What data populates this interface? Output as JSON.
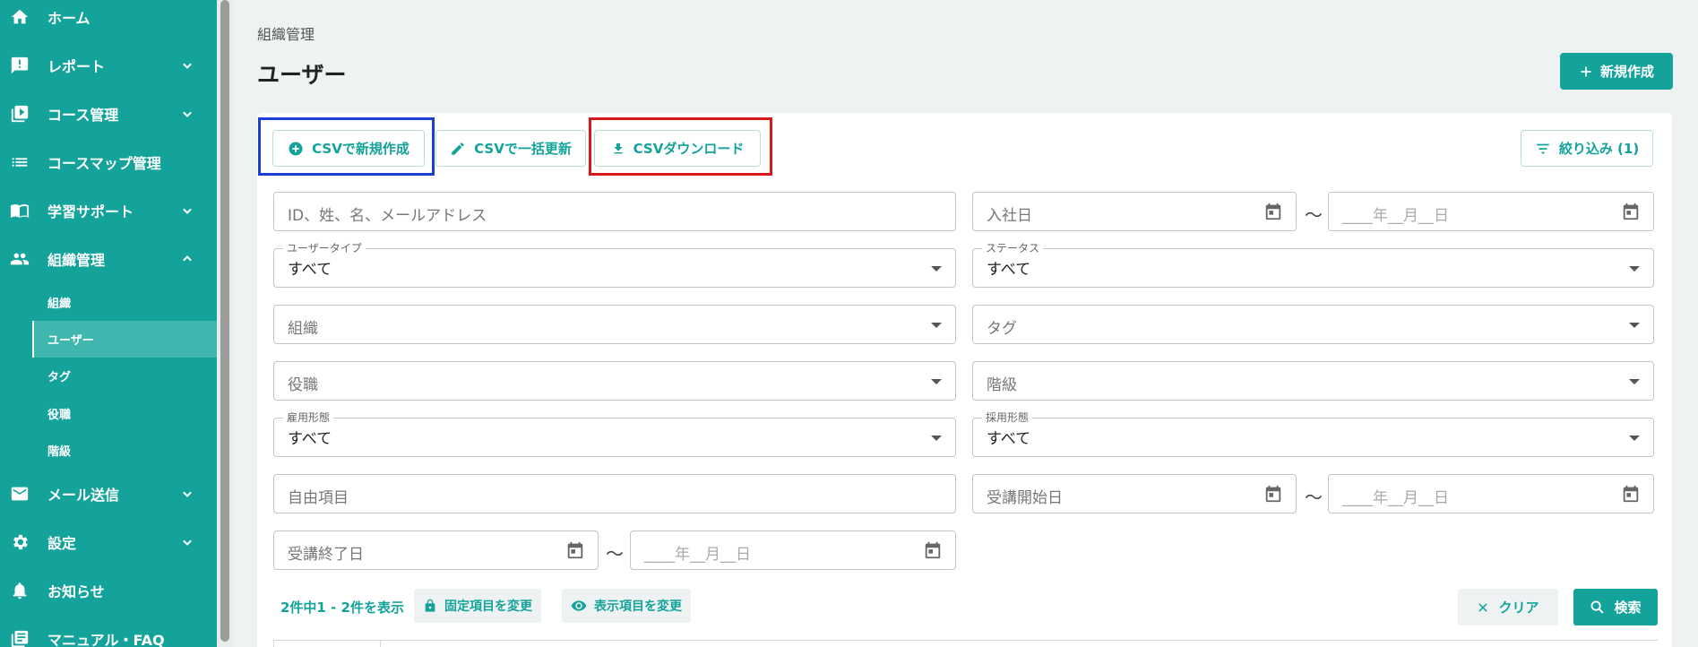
{
  "sidebar": {
    "items": [
      {
        "label": "ホーム",
        "icon": "home-icon",
        "expand": "none"
      },
      {
        "label": "レポート",
        "icon": "report-icon",
        "expand": "down"
      },
      {
        "label": "コース管理",
        "icon": "course-play-icon",
        "expand": "down"
      },
      {
        "label": "コースマップ管理",
        "icon": "list-icon",
        "expand": "none"
      },
      {
        "label": "学習サポート",
        "icon": "book-icon",
        "expand": "down"
      },
      {
        "label": "組織管理",
        "icon": "people-icon",
        "expand": "up"
      },
      {
        "label": "メール送信",
        "icon": "mail-icon",
        "expand": "down"
      },
      {
        "label": "設定",
        "icon": "gear-icon",
        "expand": "down"
      },
      {
        "label": "お知らせ",
        "icon": "bell-icon",
        "expand": "none"
      },
      {
        "label": "マニュアル・FAQ",
        "icon": "manual-icon",
        "expand": "none"
      }
    ],
    "subitems": [
      {
        "label": "組織",
        "active": false
      },
      {
        "label": "ユーザー",
        "active": true
      },
      {
        "label": "タグ",
        "active": false
      },
      {
        "label": "役職",
        "active": false
      },
      {
        "label": "階級",
        "active": false
      }
    ]
  },
  "header": {
    "breadcrumb": "組織管理",
    "title": "ユーザー",
    "new_button": "新規作成"
  },
  "toolbar": {
    "csv_create": "CSVで新規作成",
    "csv_update": "CSVで一括更新",
    "csv_download": "CSVダウンロード",
    "filter": "絞り込み (1)"
  },
  "filters": {
    "keyword_placeholder": "ID、姓、名、メールアドレス",
    "hire_date_placeholder": "入社日",
    "date_placeholder": "____年__月__日",
    "user_type_label": "ユーザータイプ",
    "user_type_value": "すべて",
    "status_label": "ステータス",
    "status_value": "すべて",
    "org_placeholder": "組織",
    "tag_placeholder": "タグ",
    "position_placeholder": "役職",
    "rank_placeholder": "階級",
    "employment_label": "雇用形態",
    "employment_value": "すべて",
    "recruit_label": "採用形態",
    "recruit_value": "すべて",
    "free_placeholder": "自由項目",
    "start_date_placeholder": "受講開始日",
    "end_date_placeholder": "受講終了日",
    "tilde": "～"
  },
  "results": {
    "count": "2件中1 - 2件を表示",
    "fixed_columns": "固定項目を変更",
    "display_columns": "表示項目を変更",
    "clear": "クリア",
    "search": "検索"
  },
  "colors": {
    "accent": "#14a39a",
    "highlight_blue": "#1a3fd6",
    "highlight_red": "#d61a1a"
  }
}
